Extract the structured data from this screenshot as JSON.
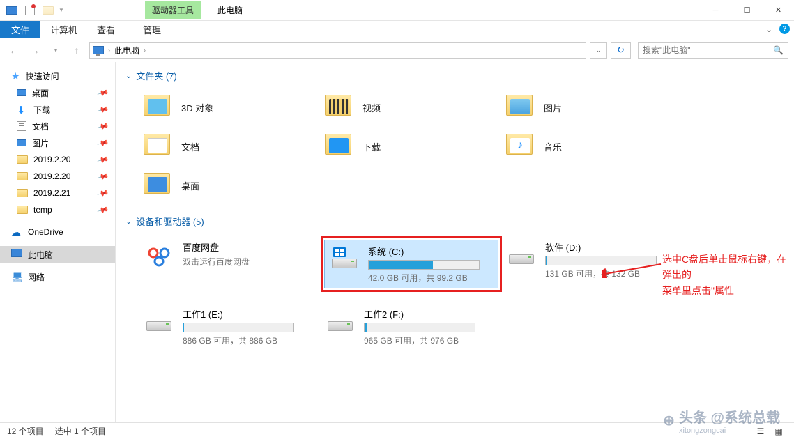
{
  "title": "此电脑",
  "ctx_tab": "驱动器工具",
  "ribbon": {
    "file": "文件",
    "tabs": [
      "计算机",
      "查看"
    ],
    "ctx_sub": "管理"
  },
  "nav": {
    "path": "此电脑",
    "search_placeholder": "搜索\"此电脑\""
  },
  "sidebar": {
    "quick_access": "快速访问",
    "items": [
      "桌面",
      "下载",
      "文档",
      "图片",
      "2019.2.20",
      "2019.2.20",
      "2019.2.21",
      "temp"
    ],
    "onedrive": "OneDrive",
    "this_pc": "此电脑",
    "network": "网络"
  },
  "groups": {
    "folders": {
      "title": "文件夹 (7)",
      "items": [
        "3D 对象",
        "视频",
        "图片",
        "文档",
        "下载",
        "音乐",
        "桌面"
      ]
    },
    "drives": {
      "title": "设备和驱动器 (5)",
      "baidu": {
        "name": "百度网盘",
        "sub": "双击运行百度网盘"
      },
      "c": {
        "name": "系统 (C:)",
        "sub": "42.0 GB 可用，共 99.2 GB",
        "fill": 58
      },
      "d": {
        "name": "软件 (D:)",
        "sub": "131 GB 可用，共 132 GB",
        "fill": 1
      },
      "e": {
        "name": "工作1 (E:)",
        "sub": "886 GB 可用，共 886 GB",
        "fill": 0.5
      },
      "f": {
        "name": "工作2 (F:)",
        "sub": "965 GB 可用，共 976 GB",
        "fill": 2
      }
    }
  },
  "annotation": {
    "line1": "选中C盘后单击鼠标右键，在弹出的",
    "line2": "菜单里点击\"属性"
  },
  "status": {
    "count": "12 个项目",
    "selected": "选中 1 个项目"
  },
  "watermark": {
    "main": "头条 @系统总载",
    "sub": "xitongzongcai"
  }
}
